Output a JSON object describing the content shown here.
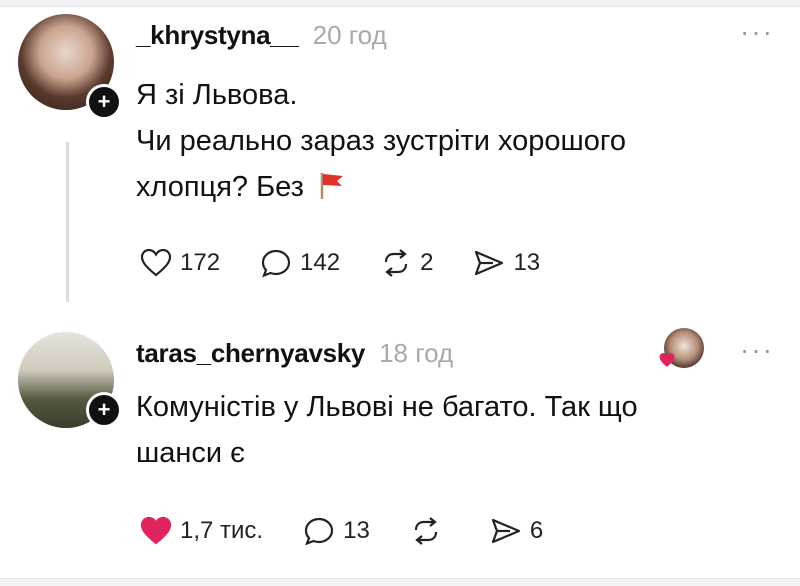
{
  "posts": [
    {
      "username": "_khrystyna__",
      "time": "20 год",
      "lines": [
        "Я зі Львова.",
        "Чи реально зараз зустріти хорошого",
        "хлопця? Без"
      ],
      "likes": "172",
      "comments": "142",
      "reposts": "2",
      "shares": "13",
      "liked": false
    },
    {
      "username": "taras_chernyavsky",
      "time": "18 год",
      "lines": [
        "Комуністів у Львові не багато. Так що",
        "шанси є"
      ],
      "likes": "1,7 тис.",
      "comments": "13",
      "reposts": "",
      "shares": "6",
      "liked": true
    }
  ],
  "icons": {
    "more": "more-icon",
    "follow": "plus-icon",
    "like": "heart-icon",
    "comment": "comment-icon",
    "repost": "repost-icon",
    "share": "share-icon",
    "flag": "red-flag-icon"
  },
  "colors": {
    "liked_heart": "#e0245e",
    "time": "#a9a9a9",
    "flag": "#e0322d"
  },
  "follow_symbol": "+",
  "more_symbol": "···"
}
